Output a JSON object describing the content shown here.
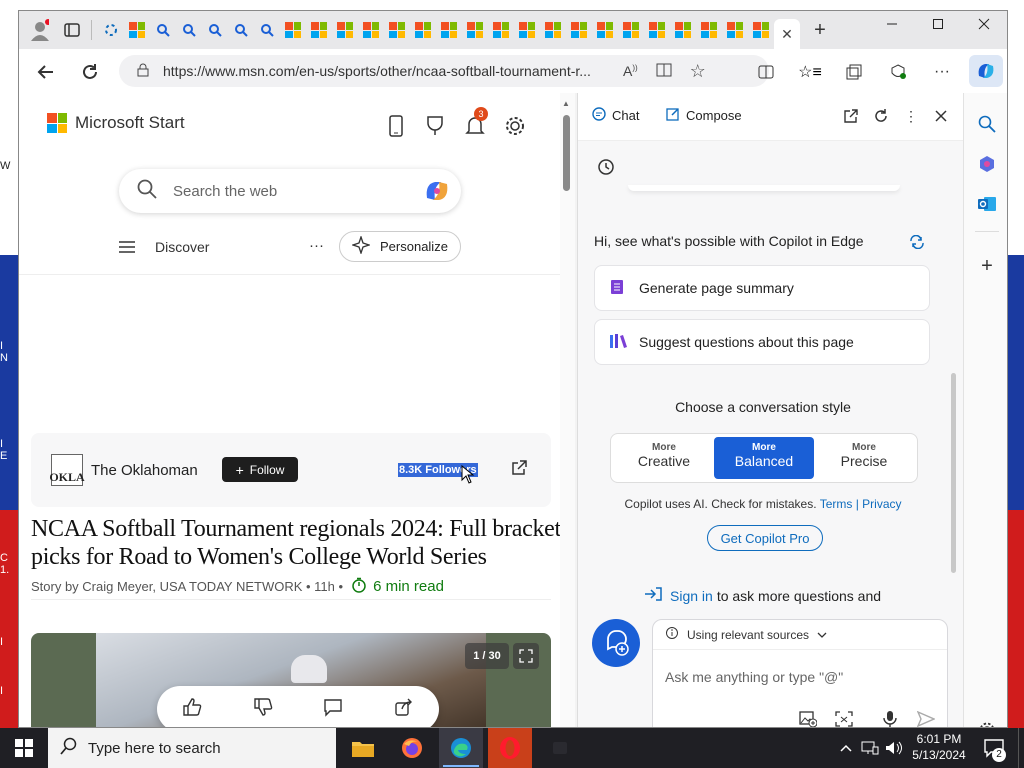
{
  "browser": {
    "url": "https://www.msn.com/en-us/sports/other/ncaa-softball-tournament-r..."
  },
  "msn": {
    "brand": "Microsoft Start",
    "notif_count": "3",
    "search_placeholder": "Search the web",
    "discover": "Discover",
    "more": "···",
    "personalize": "Personalize",
    "publisher": "The Oklahoman",
    "follow": "Follow",
    "followers": "8.3K Followers",
    "headline": "NCAA Softball Tournament regionals 2024: Full bracket picks for Road to Women's College World Series",
    "byline": "Story by Craig Meyer, USA TODAY NETWORK • 11h •",
    "readtime": "6 min read",
    "gallery_count": "1 / 30"
  },
  "copilot": {
    "tab_chat": "Chat",
    "tab_compose": "Compose",
    "greeting": "Hi, see what's possible with Copilot in Edge",
    "suggestions": [
      "Generate page summary",
      "Suggest questions about this page"
    ],
    "style_heading": "Choose a conversation style",
    "styles": [
      {
        "top": "More",
        "label": "Creative"
      },
      {
        "top": "More",
        "label": "Balanced"
      },
      {
        "top": "More",
        "label": "Precise"
      }
    ],
    "disclaimer": "Copilot uses AI. Check for mistakes.",
    "terms": "Terms",
    "sep": "|",
    "privacy": "Privacy",
    "pro_button": "Get Copilot Pro",
    "signin": "Sign in",
    "signin_rest": "to ask more questions and",
    "sources": "Using relevant sources",
    "input_placeholder": "Ask me anything or type \"@\""
  },
  "taskbar": {
    "search": "Type here to search",
    "time": "6:01 PM",
    "date": "5/13/2024",
    "notif_badge": "2"
  },
  "colors": {
    "accent": "#0f6cbd",
    "balanced": "#1a5fd6",
    "green": "#107c10"
  }
}
